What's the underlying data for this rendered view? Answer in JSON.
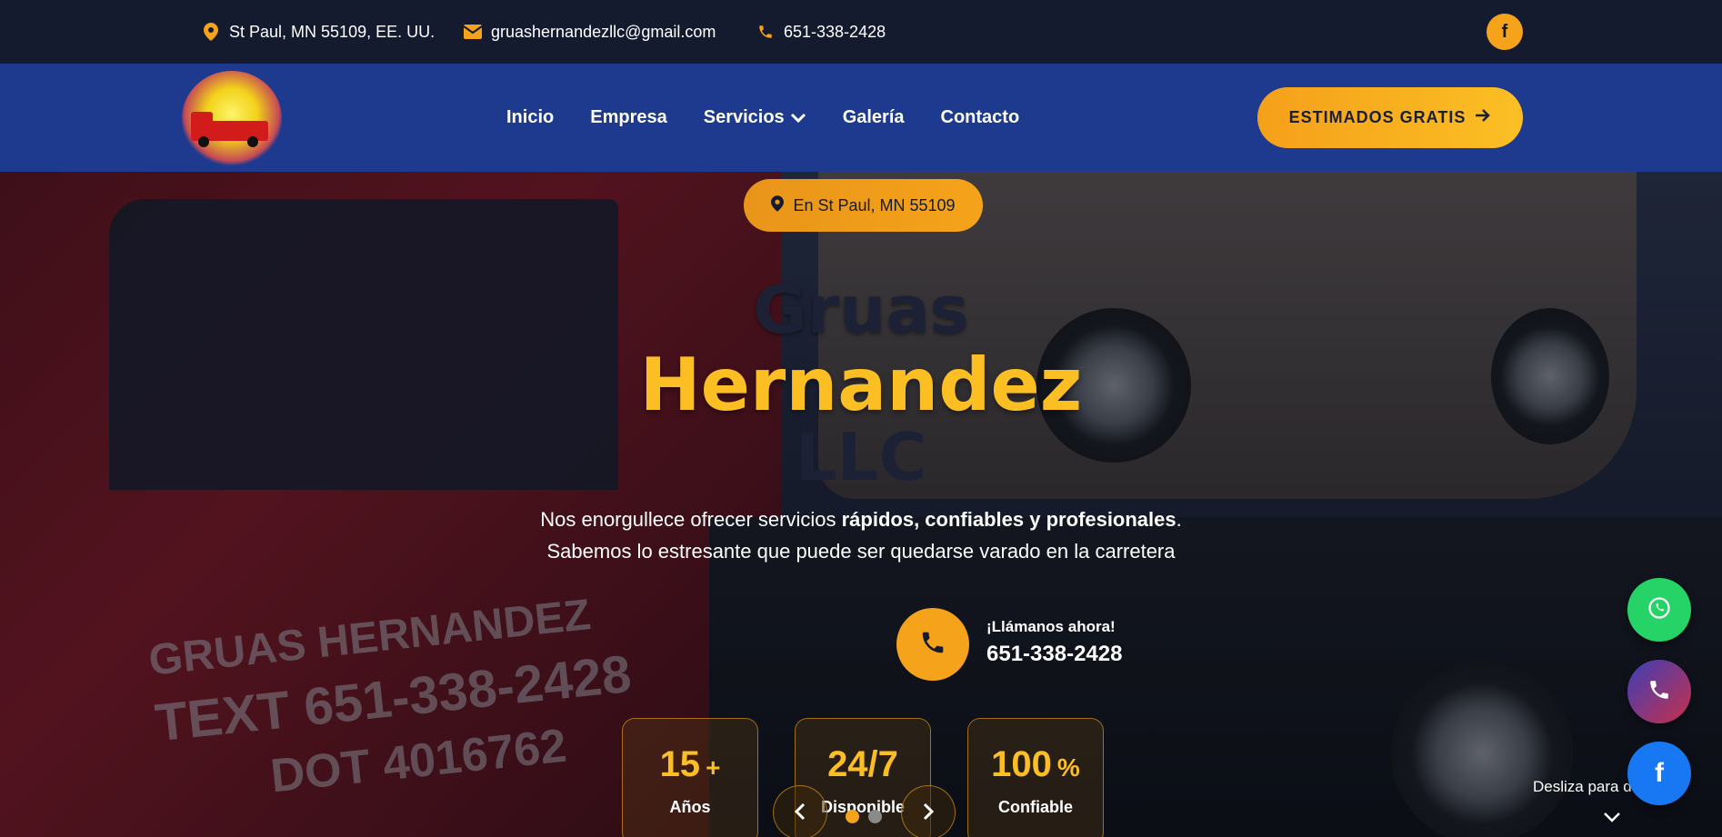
{
  "topbar": {
    "address": "St Paul, MN 55109, EE. UU.",
    "email": "gruashernandezllc@gmail.com",
    "phone": "651-338-2428",
    "social_icon": "facebook-icon"
  },
  "nav": {
    "logo_alt": "Gruas Hernandez",
    "items": [
      {
        "label": "Inicio"
      },
      {
        "label": "Empresa"
      },
      {
        "label": "Servicios"
      },
      {
        "label": "Galería"
      },
      {
        "label": "Contacto"
      }
    ],
    "cta_label": "ESTIMADOS GRATIS"
  },
  "hero": {
    "location_pill": "En St Paul, MN 55109",
    "title_line1": "Gruas",
    "title_line2": "Hernandez",
    "title_line3": "LLC",
    "desc_line1_pre": "Nos enorgullece ofrecer servicios",
    "desc_line1_bold": "rápidos, confiables y profesionales",
    "desc_line1_post": ".",
    "desc_line2": "Sabemos lo estresante que puede ser quedarse varado en la carretera",
    "call_label": "¡Llámanos ahora!",
    "call_number": "651-338-2428",
    "truck_text_1": "GRUAS HERNANDEZ",
    "truck_text_2": "TEXT 651-338-2428",
    "truck_text_3": "DOT 4016762",
    "stats": [
      {
        "value": "15",
        "suffix": "+",
        "label": "Años"
      },
      {
        "value": "24/7",
        "suffix": "",
        "label": "Disponible"
      },
      {
        "value": "100",
        "suffix": "%",
        "label": "Confiable"
      }
    ],
    "scroll_hint": "Desliza para descubrir"
  },
  "colors": {
    "accent": "#f5a31a",
    "nav_bg": "#1e3a8f",
    "topbar_bg": "#151b2e",
    "whatsapp": "#25d366",
    "facebook": "#1877f2"
  }
}
